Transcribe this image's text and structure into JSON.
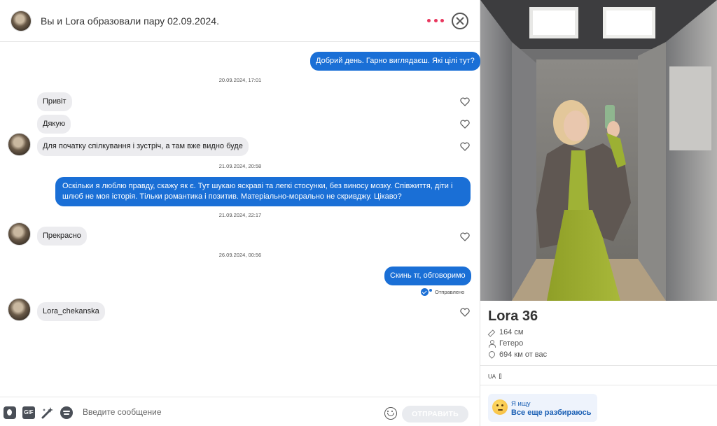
{
  "header": {
    "title": "Вы и Lora образовали пару 02.09.2024."
  },
  "messages": [
    {
      "dir": "out",
      "text": "Добрий день. Гарно виглядаєш. Які цілі тут?"
    },
    {
      "ts": "20.09.2024, 17:01"
    },
    {
      "dir": "in",
      "text": "Привіт"
    },
    {
      "dir": "in",
      "text": "Дякую"
    },
    {
      "dir": "in",
      "text": "Для початку спілкування і зустріч, а там вже видно буде"
    },
    {
      "ts": "21.09.2024, 20:58"
    },
    {
      "dir": "out",
      "text": "Оскільки я люблю правду, скажу як є. Тут шукаю яскраві та легкі стосунки, без виносу мозку. Співжиття, діти і шлюб не моя історія. Тільки романтика і позитив. Матеріально-морально не скривджу. Цікаво?"
    },
    {
      "ts": "21.09.2024, 22:17"
    },
    {
      "dir": "in",
      "text": "Прекрасно"
    },
    {
      "ts": "26.09.2024, 00:56"
    },
    {
      "dir": "out",
      "text": "Скинь тг, обговоримо"
    },
    {
      "dir": "in",
      "text": "Lora_chekanska"
    }
  ],
  "sent_status": "Отправлено",
  "input": {
    "placeholder": "Введите сообщение",
    "gif_label": "GIF",
    "send_label": "ОТПРАВИТЬ"
  },
  "profile": {
    "name_age": "Lora 36",
    "height": "164 см",
    "orientation": "Гетеро",
    "distance": "694 км от вас",
    "lang": "UA",
    "seeking_label": "Я ищу",
    "seeking_value": "Все еще разбираюсь"
  },
  "colors": {
    "accent": "#1a6fd6",
    "more_dots": "#e8365d",
    "incoming_bubble": "#ececef"
  }
}
